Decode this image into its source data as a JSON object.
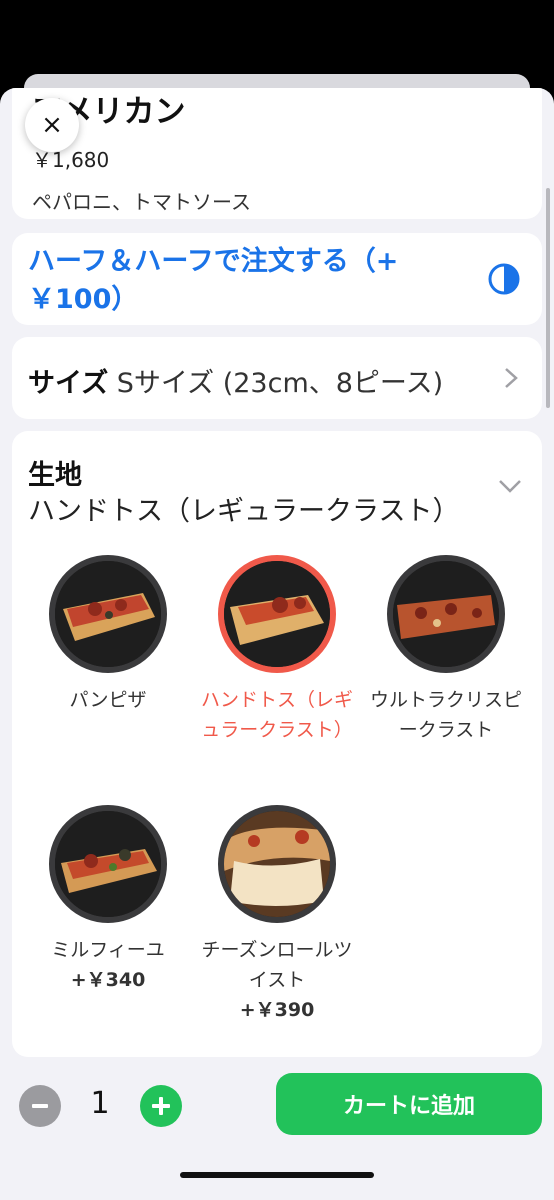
{
  "product": {
    "name": "アメリカン",
    "price": "￥1,680",
    "description": "ペパロニ、トマトソース"
  },
  "close_label": "×",
  "half_and_half": {
    "label": "ハーフ＆ハーフで注文する（+￥100）",
    "icon": "half-circle-icon",
    "color": "#1a73e8"
  },
  "size": {
    "label": "サイズ",
    "value": "Sサイズ (23cm、8ピース)"
  },
  "crust": {
    "title": "生地",
    "selected": "ハンドトス（レギュラークラスト）",
    "options": [
      {
        "label": "パンピザ",
        "price": ""
      },
      {
        "label": "ハンドトス（レギュラークラスト）",
        "price": ""
      },
      {
        "label": "ウルトラクリスピークラスト",
        "price": ""
      },
      {
        "label": "ミルフィーユ",
        "price": "+￥340"
      },
      {
        "label": "チーズンロールツイスト",
        "price": "+￥390"
      }
    ],
    "selected_color": "#f0594a"
  },
  "cart": {
    "quantity": "1",
    "add_label": "カートに追加",
    "accent": "#22c25a"
  }
}
